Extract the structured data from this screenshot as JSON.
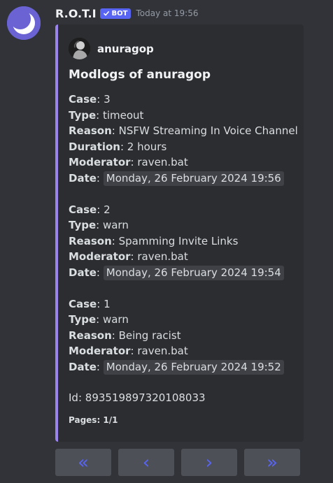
{
  "message": {
    "author": "R.O.T.I",
    "bot_badge": "BOT",
    "timestamp": "Today at 19:56"
  },
  "embed": {
    "accent_color": "#9b84ee",
    "author_name": "anuragop",
    "title": "Modlogs of anuragop",
    "cases": [
      {
        "case_label": "Case",
        "case": "3",
        "type_label": "Type",
        "type": "timeout",
        "reason_label": "Reason",
        "reason": "NSFW Streaming In Voice Channel",
        "duration_label": "Duration",
        "duration": "2 hours",
        "moderator_label": "Moderator",
        "moderator": "raven.bat",
        "date_label": "Date",
        "date": "Monday, 26 February 2024 19:56"
      },
      {
        "case_label": "Case",
        "case": "2",
        "type_label": "Type",
        "type": "warn",
        "reason_label": "Reason",
        "reason": "Spamming Invite Links",
        "moderator_label": "Moderator",
        "moderator": "raven.bat",
        "date_label": "Date",
        "date": "Monday, 26 February 2024 19:54"
      },
      {
        "case_label": "Case",
        "case": "1",
        "type_label": "Type",
        "type": "warn",
        "reason_label": "Reason",
        "reason": "Being racist",
        "moderator_label": "Moderator",
        "moderator": "raven.bat",
        "date_label": "Date",
        "date": "Monday, 26 February 2024 19:52"
      }
    ],
    "id_label": "Id",
    "id": "893519897320108033",
    "footer": "Pages: 1/1"
  },
  "buttons": [
    {
      "icon": "double-chevron-left-icon",
      "glyph": "«"
    },
    {
      "icon": "chevron-left-icon",
      "glyph": "‹"
    },
    {
      "icon": "chevron-right-icon",
      "glyph": "›"
    },
    {
      "icon": "double-chevron-right-icon",
      "glyph": "»"
    }
  ]
}
